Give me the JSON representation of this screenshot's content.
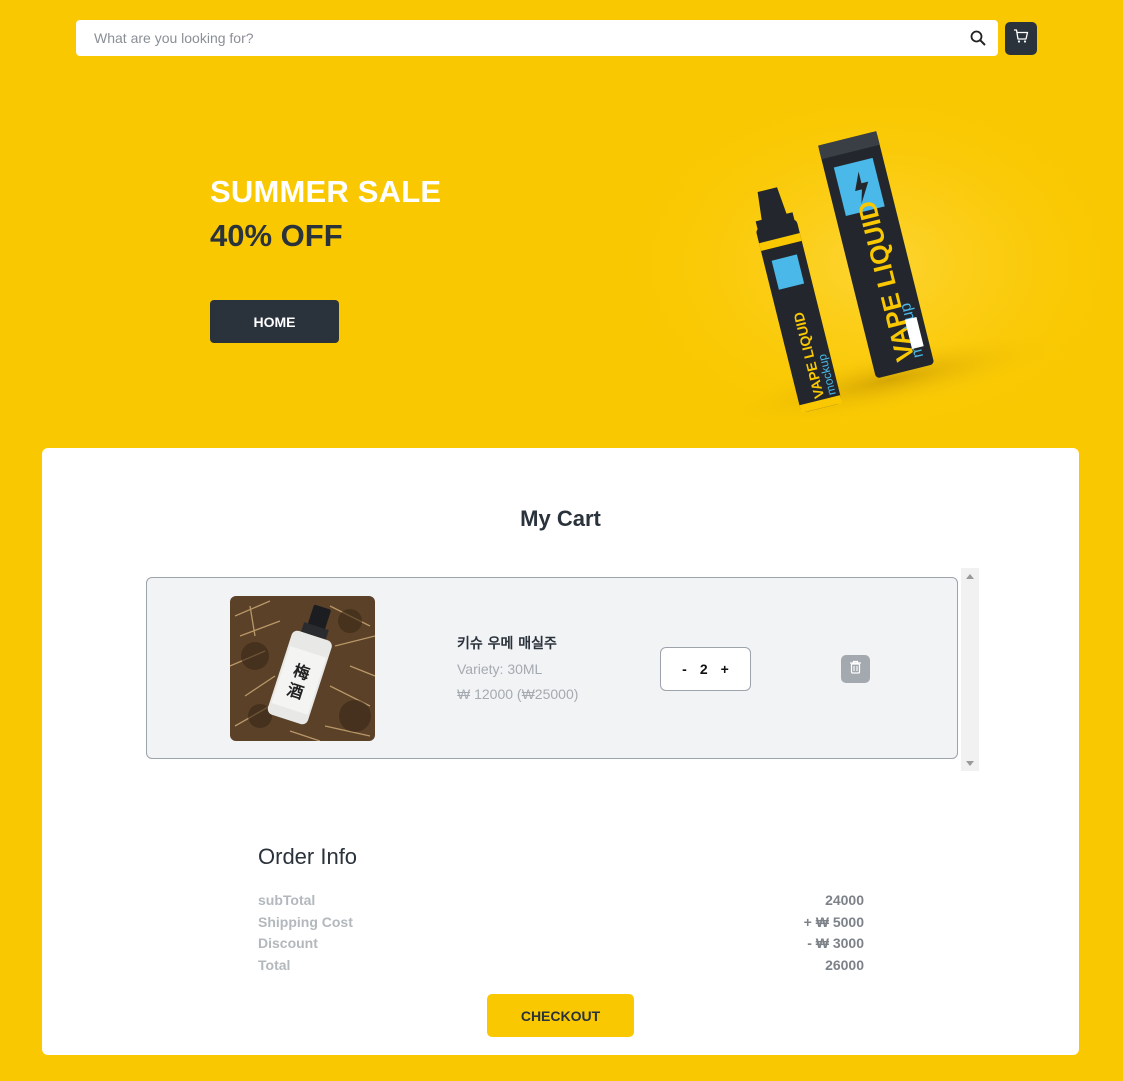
{
  "search": {
    "placeholder": "What are you looking for?"
  },
  "hero": {
    "line1": "SUMMER SALE",
    "line2": "40% OFF",
    "button_label": "HOME",
    "product_text": "VAPE LIQUID",
    "product_subtext": "mockup"
  },
  "cart": {
    "title": "My Cart",
    "items": [
      {
        "name": "키슈 우메 매실주",
        "variety": "Variety: 30ML",
        "price": "₩ 12000 (₩25000)",
        "quantity": "2",
        "label_text": "梅酒"
      }
    ]
  },
  "order": {
    "title": "Order Info",
    "rows": [
      {
        "label": "subTotal",
        "value": "24000"
      },
      {
        "label": "Shipping Cost",
        "value": "+ ₩ 5000"
      },
      {
        "label": "Discount",
        "value": "- ₩ 3000"
      },
      {
        "label": "Total",
        "value": "26000"
      }
    ],
    "checkout_label": "CHECKOUT"
  },
  "colors": {
    "background": "#F9C800",
    "dark": "#2a323b",
    "accent_blue": "#4ab8e8"
  },
  "icons": [
    "search-icon",
    "cart-icon",
    "trash-icon",
    "scroll-up-icon",
    "scroll-down-icon"
  ]
}
